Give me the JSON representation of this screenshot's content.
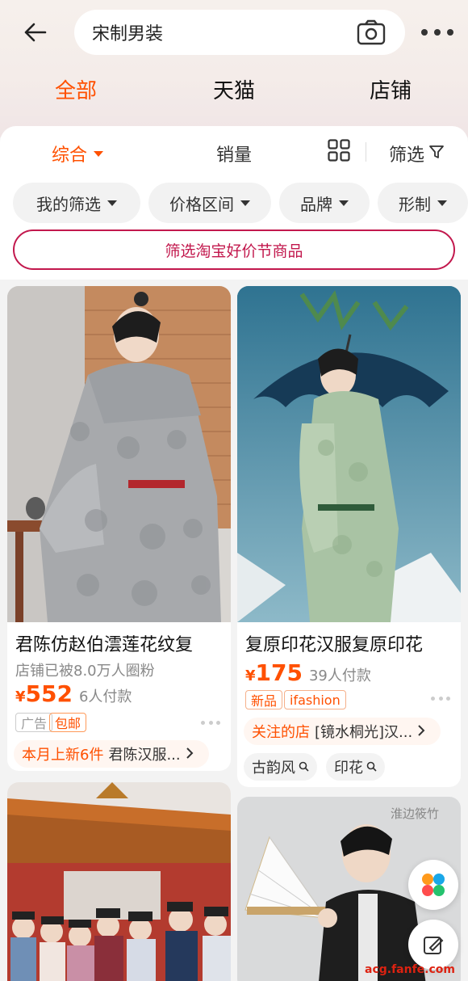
{
  "search": {
    "query": "宋制男装"
  },
  "scope_tabs": [
    "全部",
    "天猫",
    "店铺"
  ],
  "sort": {
    "comprehensive": "综合",
    "sales": "销量",
    "filter": "筛选"
  },
  "chips": [
    "我的筛选",
    "价格区间",
    "品牌",
    "形制"
  ],
  "promo": "筛选淘宝好价节商品",
  "products": [
    {
      "title": "君陈仿赵伯澐莲花纹复",
      "subtitle": "店铺已被8.0万人圈粉",
      "currency": "¥",
      "price": "552",
      "paid": "6人付款",
      "tags": [
        "广告",
        "包邮"
      ],
      "shop_promo": "本月上新6件",
      "shop_name": "君陈汉服..."
    },
    {
      "title": "复原印花汉服复原印花",
      "currency": "¥",
      "price": "175",
      "paid": "39人付款",
      "tags": [
        "新品",
        "ifashion"
      ],
      "shop_promo": "关注的店",
      "shop_name": "[镜水桐光]汉...",
      "keywords": [
        "古韵风",
        "印花"
      ]
    },
    {
      "image_text": "淮边筱竹"
    }
  ],
  "watermark": "acg.fanfe.com",
  "colors": {
    "accent": "#ff5000",
    "promo": "#c2184d"
  }
}
